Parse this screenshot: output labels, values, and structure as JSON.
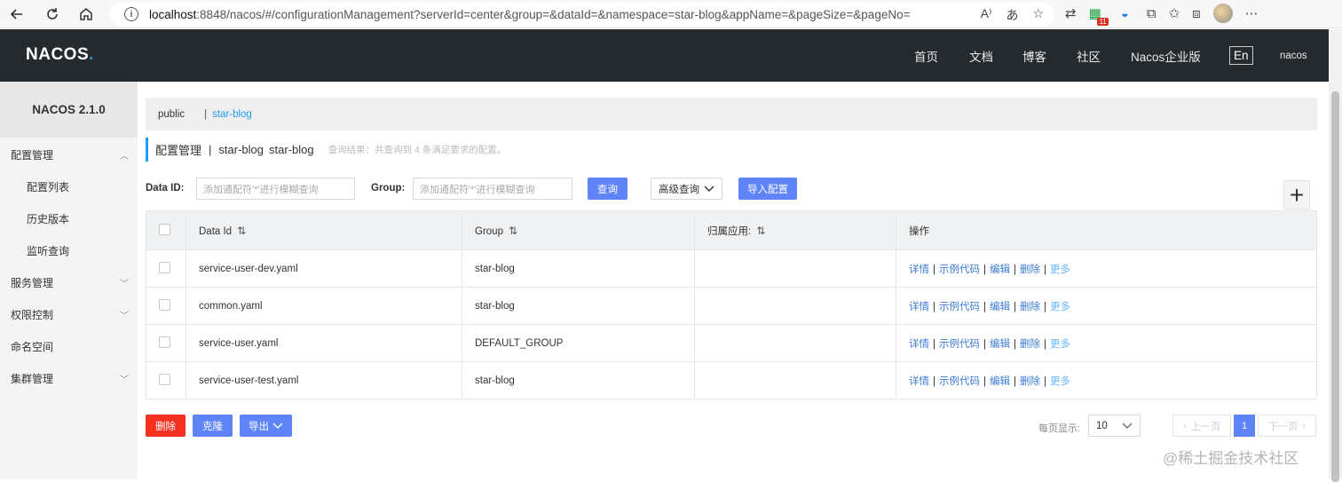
{
  "browser": {
    "url_host": "localhost",
    "url_rest": ":8848/nacos/#/configurationManagement?serverId=center&group=&dataId=&namespace=star-blog&appName=&pageSize=&pageNo=",
    "ext_badge": "11"
  },
  "header": {
    "logo": "NACOS",
    "logo_dot": ".",
    "nav": [
      "首页",
      "文档",
      "博客",
      "社区",
      "Nacos企业版"
    ],
    "lang": "En",
    "user": "nacos"
  },
  "sidebar": {
    "version": "NACOS 2.1.0",
    "items": [
      {
        "label": "配置管理"
      },
      {
        "label": "配置列表"
      },
      {
        "label": "历史版本"
      },
      {
        "label": "监听查询"
      },
      {
        "label": "服务管理"
      },
      {
        "label": "权限控制"
      },
      {
        "label": "命名空间"
      },
      {
        "label": "集群管理"
      }
    ]
  },
  "namespace_bar": {
    "public": "public",
    "separator": "|",
    "current": "star-blog"
  },
  "page": {
    "title": "配置管理",
    "sep": "|",
    "ns_name": "star-blog",
    "ns_id": "star-blog",
    "result": "查询结果：共查询到 4 条满足要求的配置。"
  },
  "filters": {
    "dataid_label": "Data ID:",
    "dataid_placeholder": "添加通配符'*'进行模糊查询",
    "group_label": "Group:",
    "group_placeholder": "添加通配符'*'进行模糊查询",
    "query": "查询",
    "advanced": "高级查询",
    "import": "导入配置",
    "plus": "+"
  },
  "table": {
    "headers": {
      "dataid": "Data Id",
      "group": "Group",
      "app": "归属应用:",
      "ops": "操作"
    },
    "rows": [
      {
        "dataid": "service-user-dev.yaml",
        "group": "star-blog",
        "app": ""
      },
      {
        "dataid": "common.yaml",
        "group": "star-blog",
        "app": ""
      },
      {
        "dataid": "service-user.yaml",
        "group": "DEFAULT_GROUP",
        "app": ""
      },
      {
        "dataid": "service-user-test.yaml",
        "group": "star-blog",
        "app": ""
      }
    ],
    "ops": {
      "detail": "详情",
      "sample": "示例代码",
      "edit": "编辑",
      "delete": "删除",
      "more": "更多",
      "sep": "|"
    }
  },
  "footer": {
    "delete": "删除",
    "clone": "克隆",
    "export": "导出",
    "page_size_label": "每页显示:",
    "page_size": "10",
    "prev": "上一页",
    "current_page": "1",
    "next": "下一页"
  },
  "watermark": "@稀土掘金技术社区"
}
